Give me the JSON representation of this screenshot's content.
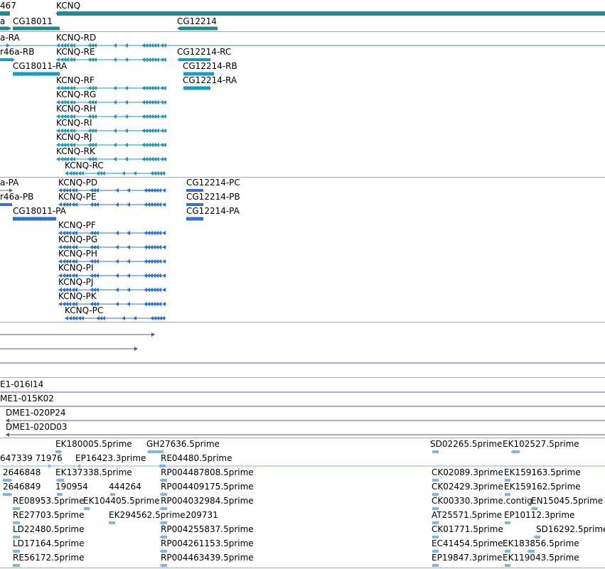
{
  "colors": {
    "gene": "#24868f",
    "transcript": "#1a9cba",
    "protein": "#3371cc",
    "clone": "#6b4a9c",
    "est": "#7fb6df",
    "divider": "#a8a8a8"
  },
  "tracks": {
    "genes": {
      "labels": [
        "467",
        "KCNQ",
        "a",
        "CG18011",
        "CG12214"
      ]
    },
    "transcripts": {
      "labels": [
        "a-RA",
        "KCNQ-RD",
        "r46a-RB",
        "KCNQ-RE",
        "CG12214-RC",
        "CG18011-RA",
        "CG12214-RB",
        "KCNQ-RF",
        "CG12214-RA",
        "KCNQ-RG",
        "KCNQ-RH",
        "KCNQ-RI",
        "KCNQ-RJ",
        "KCNQ-RK",
        "KCNQ-RC"
      ]
    },
    "proteins": {
      "labels": [
        "a-PA",
        "KCNQ-PD",
        "CG12214-PC",
        "r46a-PB",
        "KCNQ-PE",
        "CG12214-PB",
        "CG18011-PA",
        "CG12214-PA",
        "KCNQ-PF",
        "KCNQ-PG",
        "KCNQ-PH",
        "KCNQ-PI",
        "KCNQ-PJ",
        "KCNQ-PK",
        "KCNQ-PC"
      ]
    },
    "clones": {
      "labels": [
        "E1-016I14",
        "ME1-015K02",
        "DME1-020P24",
        "DME1-020D03"
      ]
    },
    "ests": {
      "labels": [
        "EK180005.5prime",
        "GH27636.5prime",
        "SD02265.5prime",
        "EK102527.5prime",
        "647339 71976",
        "EP16423.3prime",
        "RE04480.5prime",
        "2646848",
        "EK137338.5prime",
        "RP004487808.5prime",
        "CK02089.3prime",
        "EK159163.5prime",
        "2646849",
        "190954",
        "444264",
        "RP004409175.5prime",
        "CK02429.3prime",
        "EK159162.5prime",
        "RE08953.5prime",
        "EK104405.5prime",
        "RP004032984.5prime",
        "CK00330.3prime.contig",
        "EN15045.5prime",
        "RE27703.5prime",
        "EK294562.5prime",
        "209731",
        "AT25571.5prime",
        "EP10112.3prime",
        "LD22480.5prime",
        "RP004255837.5prime",
        "CK01771.5prime",
        "SD16292.5prime",
        "LD17164.5prime",
        "RP004261153.5prime",
        "EC41454.5prime",
        "EK183856.5prime",
        "RE56172.5prime",
        "RP004463439.5prime",
        "EP19847.3prime",
        "EK119043.5prime"
      ]
    }
  }
}
